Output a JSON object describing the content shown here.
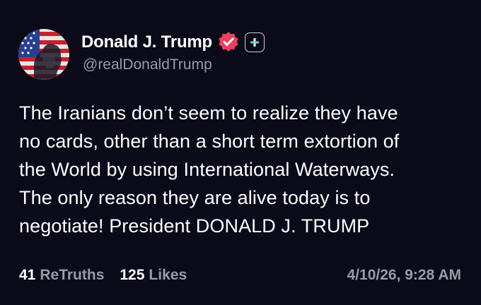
{
  "post": {
    "author": {
      "display_name": "Donald J. Trump",
      "handle": "@realDonaldTrump",
      "verified_icon": "verified-badge-icon",
      "plus_icon": "plus-icon"
    },
    "text": "The Iranians don’t seem to realize they have\nno cards, other than a short term extortion of\nthe World by using International Waterways.\nThe only reason they are alive today is to\nnegotiate! President DONALD J. TRUMP",
    "stats": {
      "retruths_count": "41",
      "retruths_label": "ReTruths",
      "likes_count": "125",
      "likes_label": "Likes"
    },
    "timestamp": "4/10/26, 9:28 AM"
  },
  "colors": {
    "background": "#0b0a19",
    "text_primary": "#ffffff",
    "text_secondary": "#9a9aa6",
    "verified_badge": "#ee3f5f",
    "plus_accent": "#5fe0c8"
  }
}
